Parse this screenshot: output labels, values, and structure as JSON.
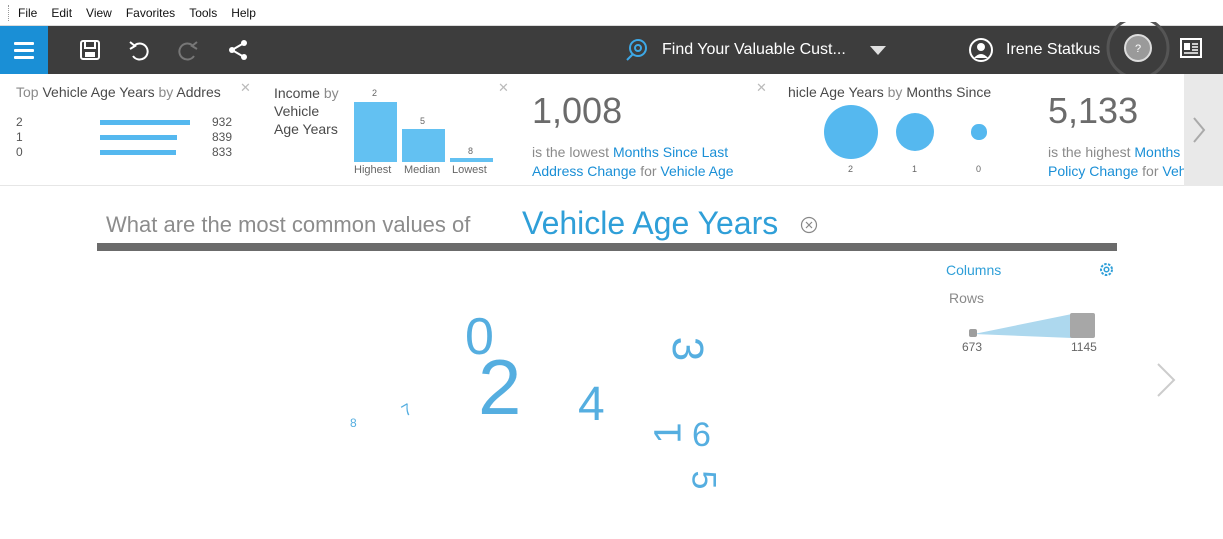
{
  "menubar": [
    "File",
    "Edit",
    "View",
    "Favorites",
    "Tools",
    "Help"
  ],
  "toolbar": {
    "story_title": "Find Your Valuable Cust...",
    "user_name": "Irene Statkus",
    "help_glyph": "?",
    "icons": [
      "menu-icon",
      "save-icon",
      "undo-icon",
      "redo-icon",
      "share-icon",
      "story-icon",
      "caret-down-icon",
      "user-icon",
      "help-icon",
      "presentation-icon"
    ]
  },
  "cards": {
    "top_values": {
      "title_pre": "Top",
      "title_field": "Vehicle Age Years",
      "title_mid": "by",
      "title_field2": "Addres",
      "rows": [
        {
          "label": "2",
          "value": "932",
          "fraction": 1.0
        },
        {
          "label": "1",
          "value": "839",
          "fraction": 0.85
        },
        {
          "label": "0",
          "value": "833",
          "fraction": 0.84
        }
      ]
    },
    "income": {
      "line1": "Income",
      "line1_by": "by",
      "line2": "Vehicle",
      "line3": "Age Years",
      "bars": [
        {
          "caption": "Highest",
          "top_label": "2",
          "level": 1.0
        },
        {
          "caption": "Median",
          "top_label": "5",
          "level": 0.55
        },
        {
          "caption": "Lowest",
          "top_label": "8",
          "level": 0.07
        }
      ]
    },
    "kpi_lowest": {
      "value": "1,008",
      "pre": "is the lowest",
      "field": "Months Since Last Address Change",
      "mid": "for",
      "field2": "Vehicle Age"
    },
    "bubbles": {
      "title_field": "hicle Age Years",
      "title_mid": "by",
      "title_field2": "Months Since",
      "items": [
        {
          "label": "2",
          "size": 1.0
        },
        {
          "label": "1",
          "size": 0.72
        },
        {
          "label": "0",
          "size": 0.28
        }
      ]
    },
    "kpi_highest": {
      "value": "5,133",
      "pre": "is the highest",
      "field": "Months Sinc",
      "field_b": "Policy Change",
      "mid": "for",
      "field2": "Vehic"
    }
  },
  "question": {
    "prefix": "What are the most common values of",
    "subject": "Vehicle Age Years"
  },
  "controls": {
    "columns_label": "Columns",
    "rows_label": "Rows",
    "rows_min": "673",
    "rows_max": "1145"
  },
  "word_cloud": [
    {
      "text": "0"
    },
    {
      "text": "2"
    },
    {
      "text": "3"
    },
    {
      "text": "4"
    },
    {
      "text": "1"
    },
    {
      "text": "6"
    },
    {
      "text": "5"
    },
    {
      "text": "7"
    },
    {
      "text": "8"
    }
  ],
  "colors": {
    "accent": "#1a8fd6",
    "toolbar": "#3d3d3d",
    "bar": "#55b8ef",
    "cloud": "#55aee0"
  }
}
